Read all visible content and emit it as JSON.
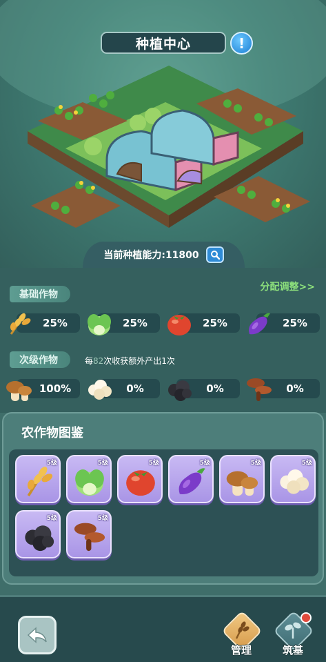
{
  "header": {
    "title": "种植中心"
  },
  "capacity": {
    "label": "当前种植能力:11800"
  },
  "basic": {
    "tag": "基础作物",
    "allocate_link": "分配调整>>",
    "crops": [
      {
        "icon": "wheat-icon",
        "percent": "25%"
      },
      {
        "icon": "cabbage-icon",
        "percent": "25%"
      },
      {
        "icon": "tomato-icon",
        "percent": "25%"
      },
      {
        "icon": "eggplant-icon",
        "percent": "25%"
      }
    ]
  },
  "secondary": {
    "tag": "次级作物",
    "note_prefix": "每",
    "note_count": "82",
    "note_suffix": "次收获额外产出1次",
    "crops": [
      {
        "icon": "mushroom-icon",
        "percent": "100%"
      },
      {
        "icon": "cauliflower-icon",
        "percent": "0%"
      },
      {
        "icon": "truffle-icon",
        "percent": "0%"
      },
      {
        "icon": "lingzhi-icon",
        "percent": "0%"
      }
    ]
  },
  "catalog": {
    "title": "农作物图鉴",
    "cards": [
      {
        "icon": "wheat-icon",
        "level": "5级"
      },
      {
        "icon": "cabbage-icon",
        "level": "5级"
      },
      {
        "icon": "tomato-icon",
        "level": "5级"
      },
      {
        "icon": "eggplant-icon",
        "level": "5级"
      },
      {
        "icon": "mushroom-icon",
        "level": "5级"
      },
      {
        "icon": "cauliflower-icon",
        "level": "5级"
      },
      {
        "icon": "truffle-icon",
        "level": "5级"
      },
      {
        "icon": "lingzhi-icon",
        "level": "5级"
      }
    ]
  },
  "bottom": {
    "manage_label": "管理",
    "build_label": "筑基"
  },
  "colors": {
    "link_green": "#8de07c",
    "card_purple": "#b6a4ee",
    "panel_teal": "#35605e"
  }
}
